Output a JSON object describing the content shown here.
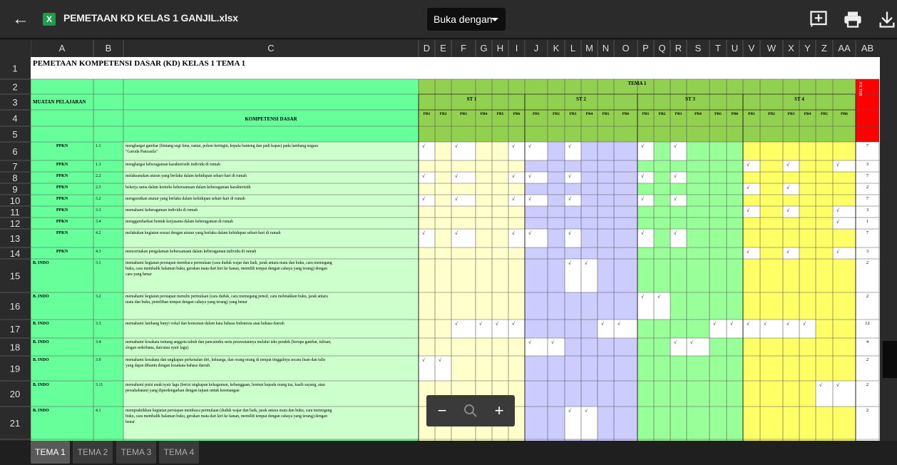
{
  "app": {
    "file_title": "PEMETAAN KD KELAS 1 GANJIL.xlsx",
    "open_with": "Buka dengan",
    "icons": [
      "back-arrow-icon",
      "excel-file-icon",
      "add-comment-icon",
      "print-icon",
      "download-icon"
    ]
  },
  "zoom": {
    "minus": "−",
    "plus": "+"
  },
  "tabs": [
    {
      "label": "TEMA 1",
      "active": true
    },
    {
      "label": "TEMA 2"
    },
    {
      "label": "TEMA 3"
    },
    {
      "label": "TEMA 4"
    }
  ],
  "columns": [
    "A",
    "B",
    "C",
    "D",
    "E",
    "F",
    "G",
    "H",
    "I",
    "J",
    "K",
    "L",
    "M",
    "N",
    "O",
    "P",
    "Q",
    "R",
    "S",
    "T",
    "U",
    "V",
    "W",
    "X",
    "Y",
    "Z",
    "AA",
    "AB"
  ],
  "rows": [
    "1",
    "2",
    "3",
    "4",
    "5",
    "6",
    "7",
    "8",
    "9",
    "10",
    "11",
    "12",
    "13",
    "14",
    "15",
    "16",
    "17",
    "18",
    "19",
    "20",
    "21"
  ],
  "sheet": {
    "title": "PEMETAAN KOMPETENSI DASAR (KD) KELAS 1 TEMA 1",
    "muatan_header": "MUATAN PELAJARAN",
    "kd_header": "KOMPETENSI DASAR",
    "tema_header": "TEMA 1",
    "filter_header": "FILTER",
    "st_headers": [
      "ST 1",
      "ST 2",
      "ST 3",
      "ST 4"
    ],
    "pb_headers": [
      "PB1",
      "PB2",
      "PB3",
      "PB4",
      "PB5",
      "PB6",
      "PB1",
      "PB2",
      "PB3",
      "PB4",
      "PB5",
      "PB6",
      "PB1",
      "PB2",
      "PB3",
      "PB4",
      "PB5",
      "PB6",
      "PB1",
      "PB2",
      "PB3",
      "PB4",
      "PB5",
      "PB6"
    ],
    "check": "√",
    "rows": [
      {
        "mp": "PPKN",
        "kd": "1.1",
        "desc": "menghargai gambar (bintang segi lima, rantai, pohon beringin, kepala banteng dan padi kapas) pada lambang negara \"Garuda Pancasila\"",
        "checks": [
          0,
          2,
          5,
          6,
          8,
          12,
          14
        ],
        "total": "7"
      },
      {
        "mp": "PPKN",
        "kd": "1.3",
        "desc": "menghargai keberagaman karakteristik individu di rumah",
        "checks": [
          18,
          20,
          23
        ],
        "total": "3"
      },
      {
        "mp": "PPKN",
        "kd": "2.2",
        "desc": "melaksanakan aturan yang berlaku dalam kehidupan sehari-hari di rumah",
        "checks": [
          0,
          2,
          5,
          6,
          8,
          12,
          14
        ],
        "total": "7"
      },
      {
        "mp": "PPKN",
        "kd": "2.3",
        "desc": "bekerja sama dalam konteks kebersamaan dalam keberagaman karakteristik",
        "checks": [
          18,
          20
        ],
        "total": "2"
      },
      {
        "mp": "PPKN",
        "kd": "3.2",
        "desc": "mengurutkan aturan yang berlaku dalam kehidupan sehari-hari di rumah",
        "checks": [
          0,
          2,
          5,
          6,
          8,
          12,
          14
        ],
        "total": "7"
      },
      {
        "mp": "PPKN",
        "kd": "3.3",
        "desc": "memahami keberagaman individu di rumah",
        "checks": [
          18,
          20,
          23
        ],
        "total": "3"
      },
      {
        "mp": "PPKN",
        "kd": "3.4",
        "desc": "menggambarkan bentuk kerjasama dalam keberagaman di rumah",
        "checks": [
          23
        ],
        "total": "1"
      },
      {
        "mp": "PPKN",
        "kd": "4.2",
        "desc": "melakukan kegiatan sesuai dengan aturan yang berlaku dalam kehidupan sehari-hari di rumah",
        "checks": [
          0,
          2,
          5,
          6,
          8,
          12,
          14
        ],
        "total": "7"
      },
      {
        "mp": "PPKN",
        "kd": "4.3",
        "desc": "menceritakan pengalaman kebersamaan dalam keberagaman individu di rumah",
        "checks": [
          18,
          20,
          23
        ],
        "total": "3"
      },
      {
        "mp": "B. INDO",
        "kd": "3.1",
        "desc": "memahami kegiatan persiapan membaca permulaan (cara duduk wajar dan baik, jarak antara mata dan buku, cara memegang buku, cara membalik halaman buku, gerakan mata dari kiri ke kanan, memilih tempat dengan cahaya yang terang) dengan cara yang benar",
        "checks": [
          8,
          9
        ],
        "total": "2"
      },
      {
        "mp": "B. INDO",
        "kd": "3.2",
        "desc": "memahami kegiatan persiapan menulis permulaan (cara duduk, cara memegang pensil, cara meletakkan buku, jarak antara mata dan buku, pemilihan tempat dengan cahaya yang terang) yang benar",
        "checks": [
          12,
          13
        ],
        "total": "2"
      },
      {
        "mp": "B. INDO",
        "kd": "3.3",
        "desc": "memahami lambang bunyi vokal dan konsonan dalam kata bahasa Indonesia atau bahasa daerah",
        "checks": [
          2,
          3,
          4,
          5,
          10,
          11,
          16,
          17,
          18,
          19,
          20,
          21
        ],
        "total": "12"
      },
      {
        "mp": "B. INDO",
        "kd": "3.4",
        "desc": "memahami kosakata tentang anggota tubuh dan pancaindra serta perawatannya melalui teks pendek (berupa gambar, tulisan, slogan sederhana, dan/atau syair lagu)",
        "checks": [
          6,
          7,
          14,
          15
        ],
        "total": "4"
      },
      {
        "mp": "B. INDO",
        "kd": "3.9",
        "desc": "memahami kosakata dan ungkapan perkenalan diri, keluarga, dan orang-orang di tempat tinggalnya secara lisan dan tulis yang dapat dibantu dengan kosakata bahasa daerah",
        "checks": [
          0,
          1
        ],
        "total": "2"
      },
      {
        "mp": "B. INDO",
        "kd": "3.11",
        "desc": "memahami puisi anak/syair lagu (berisi ungkapan kekaguman, kebanggaan, hormat kepada orang tua, kasih sayang, atau persahabatan) yang diperdengarkan dengan tujuan untuk kesenangan",
        "checks": [
          22,
          23
        ],
        "total": "2"
      },
      {
        "mp": "B. INDO",
        "kd": "4.1",
        "desc": "mempraktikkan kegiatan persiapan membaca permulaan (duduk wajar dan baik, jarak antara mata dan buku, cara memegang buku, cara membalik halaman buku, gerakan mata dari kiri ke kanan, memilih tempat dengan cahaya yang terang) dengan benar",
        "checks": [
          8,
          9
        ],
        "total": "2"
      }
    ]
  }
}
